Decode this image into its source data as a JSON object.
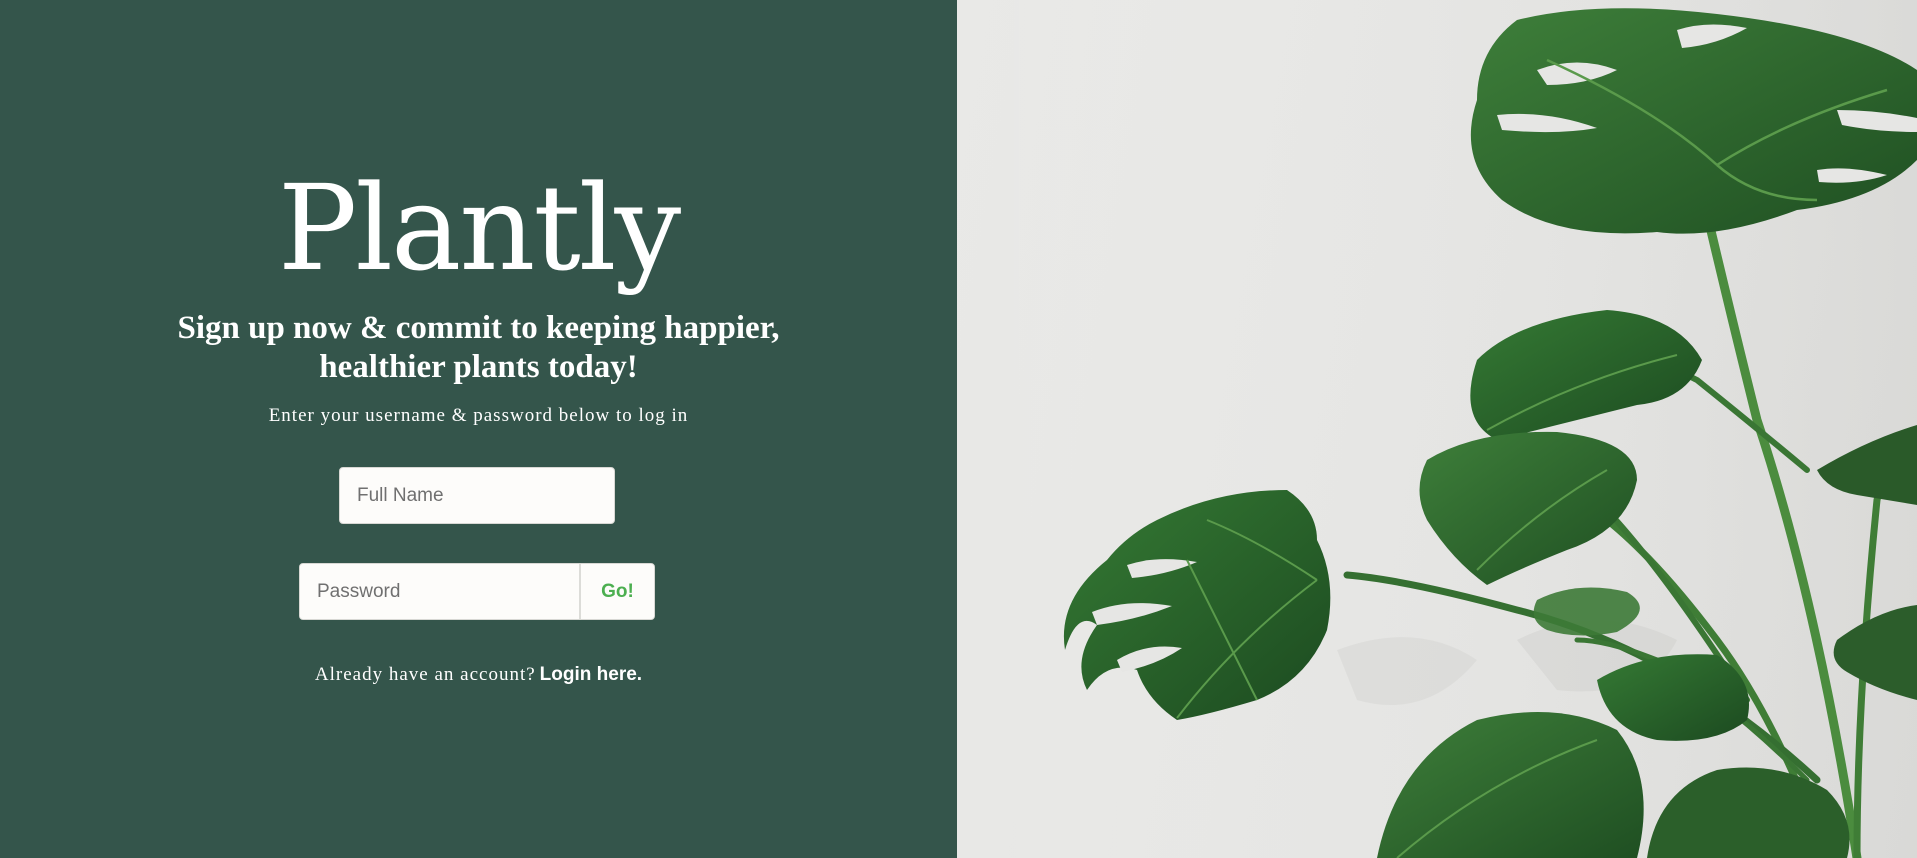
{
  "brand": {
    "name": "Plantly"
  },
  "signup": {
    "headline_line1": "Sign up now & commit to keeping happier,",
    "headline_line2": "healthier plants today!",
    "instruction": "Enter your username & password below to log in",
    "name_placeholder": "Full Name",
    "password_placeholder": "Password",
    "submit_label": "Go!",
    "login_prompt": "Already have an account?",
    "login_link": "Login here."
  },
  "colors": {
    "panel_background": "#34554b",
    "submit_text": "#4caf50",
    "leaf_green": "#2f6b2f"
  },
  "hero_image": {
    "subject": "monstera plant leaves against a light wall"
  }
}
